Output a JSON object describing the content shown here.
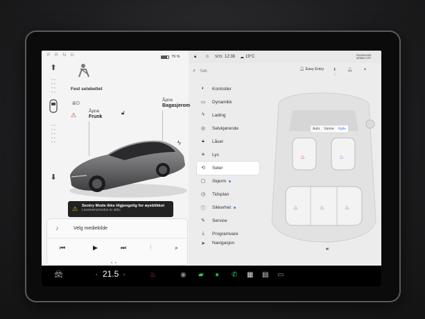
{
  "left": {
    "gear": "P R N D",
    "battery_percent": "79 %",
    "belt_label": "Fest setebeltet",
    "frunk": {
      "action": "Åpne",
      "name": "Frunk"
    },
    "trunk": {
      "action": "Åpne",
      "name": "Bagasjerom"
    },
    "sentry": {
      "title": "Sentry Mode ikke tilgjengelig for øyeblikket",
      "subtitle": "Lavstrømsmodus er aktiv"
    },
    "media": {
      "label": "Velg mediekilde"
    }
  },
  "topbar": {
    "time": "12:38",
    "temperature": "19°C",
    "brand": "PASSENGER AIRBAG OFF"
  },
  "search": {
    "placeholder": "Søk"
  },
  "profile": {
    "name": "Easy Entry"
  },
  "menu": [
    {
      "label": "Kontroller",
      "icon": "toggle-icon"
    },
    {
      "label": "Dynamikk",
      "icon": "car-icon"
    },
    {
      "label": "Lading",
      "icon": "bolt-icon"
    },
    {
      "label": "Selvkjørende",
      "icon": "steering-icon"
    },
    {
      "label": "Låser",
      "icon": "lock-icon"
    },
    {
      "label": "Lys",
      "icon": "light-icon"
    },
    {
      "label": "Seter",
      "icon": "seat-icon"
    },
    {
      "label": "Skjerm",
      "icon": "display-icon"
    },
    {
      "label": "Tidsplan",
      "icon": "clock-icon"
    },
    {
      "label": "Sikkerhet",
      "icon": "info-icon"
    },
    {
      "label": "Service",
      "icon": "wrench-icon"
    },
    {
      "label": "Programvare",
      "icon": "download-icon"
    },
    {
      "label": "Navigasjon",
      "icon": "nav-icon"
    }
  ],
  "selected_menu": "Seter",
  "seat_heat": {
    "options": [
      "Auto",
      "Varme",
      "Kjøle"
    ],
    "selected": "Kjøle"
  },
  "dock": {
    "cabin_temp": "21.5"
  },
  "colors": {
    "accent": "#3b82f6",
    "warning": "#f1c40f",
    "alert": "#c0392b"
  }
}
